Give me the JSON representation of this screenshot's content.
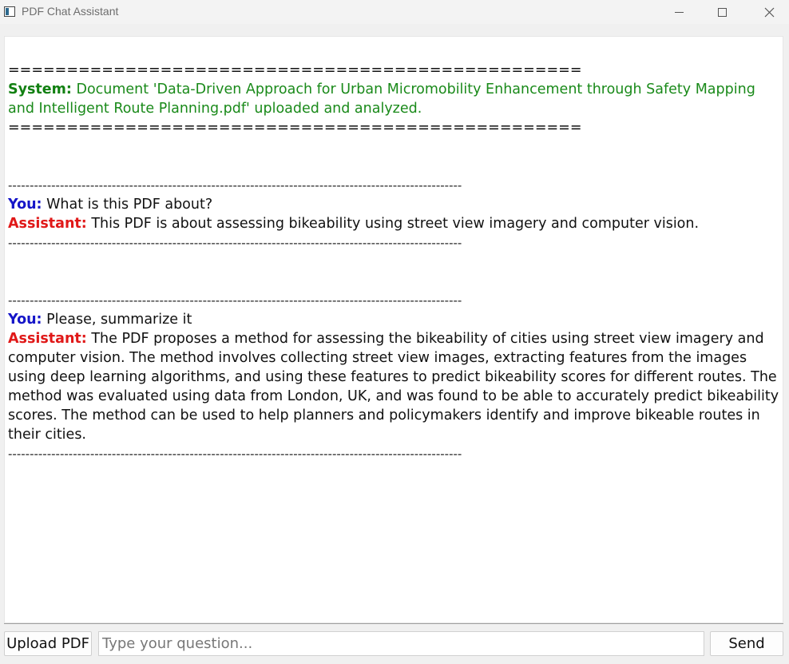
{
  "window": {
    "title": "PDF Chat Assistant"
  },
  "chat": {
    "separator_eq": "=================================================",
    "separator_dash": "---------------------------------------------------------------------------------------------------------",
    "system": {
      "label": "System:",
      "text": " Document 'Data-Driven Approach for Urban Micromobility Enhancement through Safety Mapping and Intelligent Route Planning.pdf' uploaded and analyzed."
    },
    "exchanges": [
      {
        "you_label": "You:",
        "question": " What is this PDF about?",
        "assistant_label": "Assistant:",
        "answer": " This PDF is about assessing bikeability using street view imagery and computer vision."
      },
      {
        "you_label": "You:",
        "question": " Please, summarize it",
        "assistant_label": "Assistant:",
        "answer": " The PDF proposes a method for assessing the bikeability of cities using street view imagery and computer vision. The method involves collecting street view images, extracting features from the images using deep learning algorithms, and using these features to predict bikeability scores for different routes. The method was evaluated using data from London, UK, and was found to be able to accurately predict bikeability scores. The method can be used to help planners and policymakers identify and improve bikeable routes in their cities."
      }
    ]
  },
  "controls": {
    "upload_label": "Upload PDF",
    "input_value": "",
    "input_placeholder": "Type your question...",
    "send_label": "Send"
  }
}
